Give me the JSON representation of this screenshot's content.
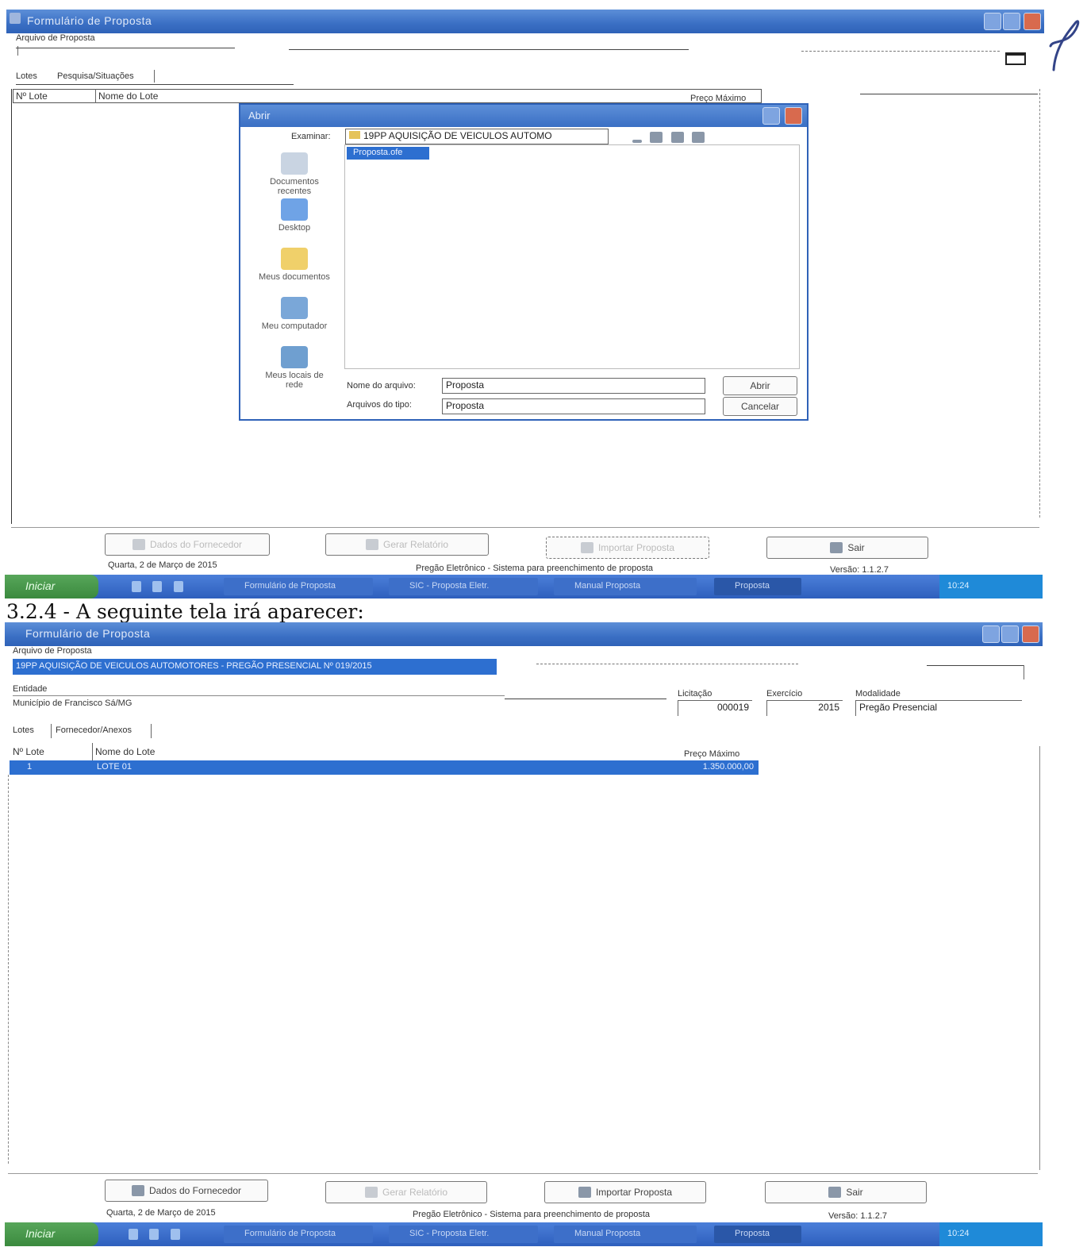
{
  "colors": {
    "titlebar": "#3a6fc4",
    "selection": "#2d6fd0",
    "taskbar": "#2e5fbd",
    "start": "#3b8a3e"
  },
  "top_window": {
    "title": "Formulário de Proposta",
    "proposal_label": "Arquivo de Proposta",
    "tabs": [
      "Lotes",
      "Pesquisa/Situações"
    ],
    "columns": [
      "Nº Lote",
      "Nome do Lote",
      "Preço Máximo"
    ],
    "buttons": {
      "b1": "Dados do Fornecedor",
      "b2": "Gerar Relatório",
      "b3": "Importar Proposta",
      "save": "Sair"
    },
    "status": {
      "date": "Quarta, 2 de Março de 2015",
      "message": "Pregão Eletrônico - Sistema para preenchimento de proposta",
      "version": "Versão: 1.1.2.7"
    }
  },
  "open_dialog": {
    "title": "Abrir",
    "look_in_label": "Examinar:",
    "look_in_value": "19PP AQUISIÇÃO DE VEICULOS AUTOMO",
    "selected_item": "Proposta.ofe",
    "places": [
      "Documentos recentes",
      "Desktop",
      "Meus documentos",
      "Meu computador",
      "Meus locais de rede"
    ],
    "filename_label": "Nome do arquivo:",
    "filename_value": "Proposta",
    "filetype_label": "Arquivos do tipo:",
    "filetype_value": "Proposta",
    "open_button": "Abrir",
    "cancel_button": "Cancelar"
  },
  "taskbar": {
    "start": "Iniciar",
    "tasks": [
      "Formulário de Proposta",
      "SIC - Proposta Eletr.",
      "Manual Proposta",
      "Proposta"
    ],
    "tray": "10:24"
  },
  "section_heading": "3.2.4 - A seguinte tela irá aparecer:",
  "bottom_window": {
    "title": "Formulário de Proposta",
    "proposal_label": "Arquivo de Proposta",
    "proposal_value": "19PP AQUISIÇÃO DE VEICULOS AUTOMOTORES - PREGÃO PRESENCIAL Nº 019/2015",
    "entity_label": "Entidade",
    "entity_value": "Município de Francisco Sá/MG",
    "licitacao_label": "Licitação",
    "licitacao_value": "000019",
    "exercicio_label": "Exercício",
    "exercicio_value": "2015",
    "modalidade_label": "Modalidade",
    "modalidade_value": "Pregão Presencial",
    "tabs": [
      "Lotes",
      "Fornecedor/Anexos"
    ],
    "columns": [
      "Nº Lote",
      "Nome do Lote",
      "Preço Máximo"
    ],
    "row": {
      "num": "1",
      "name": "LOTE 01",
      "price": "1.350.000,00"
    },
    "buttons": {
      "b1": "Dados do Fornecedor",
      "b2": "Gerar Relatório",
      "b3": "Importar Proposta",
      "save": "Sair"
    },
    "status": {
      "date": "Quarta, 2 de Março de 2015",
      "message": "Pregão Eletrônico - Sistema para preenchimento de proposta",
      "version": "Versão: 1.1.2.7"
    }
  }
}
